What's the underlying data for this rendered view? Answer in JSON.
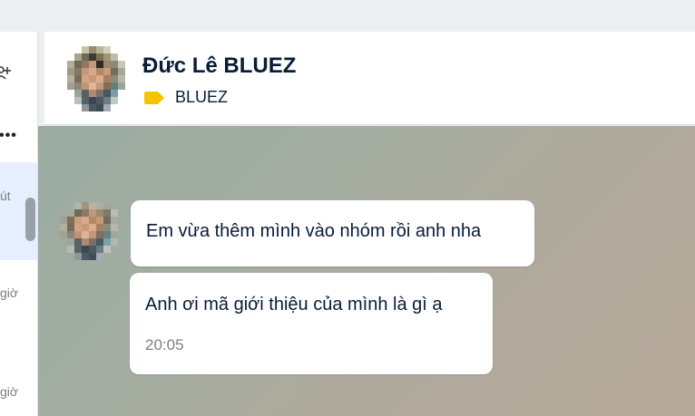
{
  "contact": {
    "name": "Đức Lê BLUEZ",
    "tag": "BLUEZ",
    "tag_color": "#f5c400"
  },
  "sidebar": {
    "preview_times": [
      "út",
      "giờ",
      "giờ"
    ]
  },
  "messages": [
    {
      "text": "Em vừa thêm mình vào nhóm rồi anh nha"
    },
    {
      "text": "Anh ơi mã giới thiệu của mình là gì ạ",
      "time": "20:05"
    }
  ],
  "colors": {
    "accent_bg": "#e5efff",
    "text_primary": "#081c36",
    "text_secondary": "#7a7f87"
  }
}
